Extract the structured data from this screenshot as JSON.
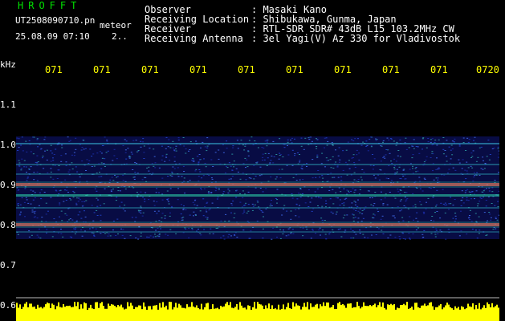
{
  "header": {
    "app_title": "HROFFT",
    "file_name": "UT2508090710.pn",
    "meteor_tag": "meteor",
    "timestamp": "25.08.09 07:10",
    "count": "2.."
  },
  "info": [
    {
      "label": "Observer",
      "value": ": Masaki Kano"
    },
    {
      "label": "Receiving Location",
      "value": ": Shibukawa, Gunma, Japan"
    },
    {
      "label": "Receiver",
      "value": ": RTL-SDR SDR# 43dB L15 103.2MHz CW"
    },
    {
      "label": "Receiving Antenna",
      "value": ": 3el Yagi(V) Az 330 for Vladivostok"
    }
  ],
  "x_axis": {
    "ticks": [
      "071",
      "071",
      "071",
      "071",
      "071",
      "071",
      "071",
      "071",
      "071",
      "0720"
    ]
  },
  "y_axis": {
    "unit": "kHz",
    "ticks": [
      "1.1",
      "1.0",
      "0.9",
      "0.8",
      "0.7",
      "0.6"
    ]
  },
  "colors": {
    "background": "#000000",
    "tick_x": "#ffff00",
    "band_base": "#1a2aa0",
    "band_mid": "#2a8a9a",
    "band_hot": "#ff3a3a",
    "band_line": "#30e0b0",
    "volume_bar": "#ffff00"
  }
}
